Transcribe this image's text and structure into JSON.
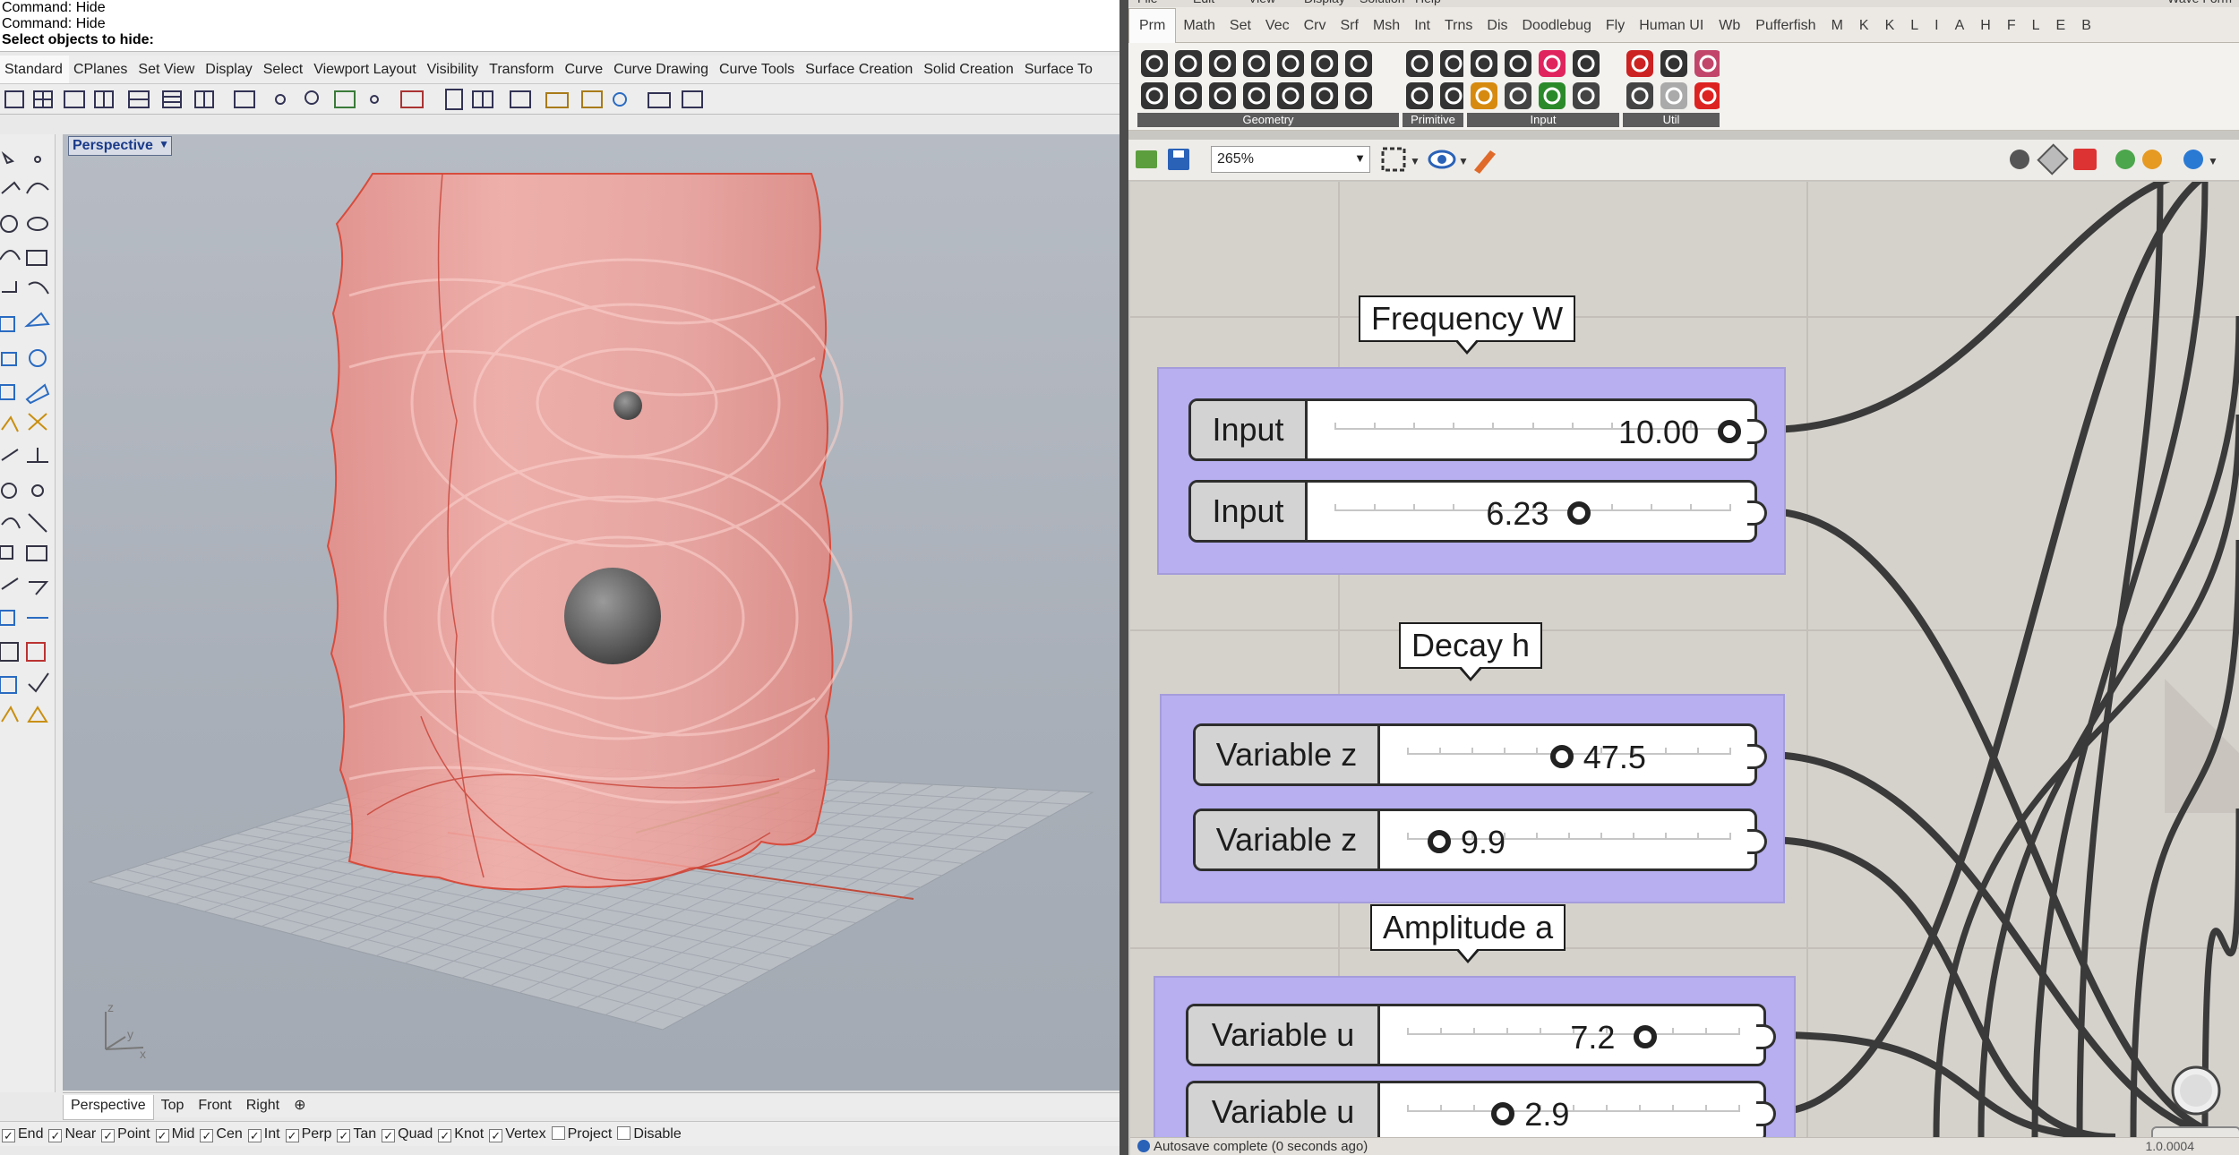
{
  "rhino": {
    "command_lines": [
      "Command: Hide",
      "Command: Hide"
    ],
    "prompt": "Select objects to hide:",
    "toolbar_tabs": [
      "Standard",
      "CPlanes",
      "Set View",
      "Display",
      "Select",
      "Viewport Layout",
      "Visibility",
      "Transform",
      "Curve",
      "Curve Drawing",
      "Curve Tools",
      "Surface Creation",
      "Solid Creation",
      "Surface To"
    ],
    "viewport_title": "Perspective",
    "axis_labels": {
      "z": "z",
      "y": "y",
      "x": "x"
    },
    "viewport_tabs": [
      "Perspective",
      "Top",
      "Front",
      "Right"
    ],
    "add_viewport_tab": "⊕",
    "osnaps": [
      {
        "label": "End",
        "checked": true
      },
      {
        "label": "Near",
        "checked": true
      },
      {
        "label": "Point",
        "checked": true
      },
      {
        "label": "Mid",
        "checked": true
      },
      {
        "label": "Cen",
        "checked": true
      },
      {
        "label": "Int",
        "checked": true
      },
      {
        "label": "Perp",
        "checked": true
      },
      {
        "label": "Tan",
        "checked": true
      },
      {
        "label": "Quad",
        "checked": true
      },
      {
        "label": "Knot",
        "checked": true
      },
      {
        "label": "Vertex",
        "checked": true
      },
      {
        "label": "Project",
        "checked": false
      },
      {
        "label": "Disable",
        "checked": false
      }
    ],
    "colors": {
      "surface": "#f0a49e",
      "edge": "#d94a3a",
      "viewport_bg": "#aeb3bb"
    }
  },
  "grasshopper": {
    "menu_partial": [
      "File",
      "Edit",
      "View",
      "Display",
      "Solution",
      "Help"
    ],
    "window_title_partial": "Wave Form",
    "tabs": [
      "Prm",
      "Math",
      "Set",
      "Vec",
      "Crv",
      "Srf",
      "Msh",
      "Int",
      "Trns",
      "Dis",
      "Doodlebug",
      "Fly",
      "Human UI",
      "Wb",
      "Pufferfish",
      "M",
      "K",
      "K",
      "L",
      "I",
      "A",
      "H",
      "F",
      "L",
      "E",
      "B"
    ],
    "ribbon_groups": [
      "Geometry",
      "Primitive",
      "Input",
      "Util"
    ],
    "zoom": "265%",
    "groups": [
      {
        "title": "Frequency W",
        "sliders": [
          {
            "label": "Input",
            "value": "10.00",
            "fraction": 1.0
          },
          {
            "label": "Input",
            "value": "6.23",
            "fraction": 0.62
          }
        ]
      },
      {
        "title": "Decay h",
        "sliders": [
          {
            "label": "Variable z",
            "value": "47.5",
            "fraction": 0.48
          },
          {
            "label": "Variable z",
            "value": "9.9",
            "fraction": 0.1
          }
        ]
      },
      {
        "title": "Amplitude a",
        "sliders": [
          {
            "label": "Variable u",
            "value": "7.2",
            "fraction": 0.72
          },
          {
            "label": "Variable u",
            "value": "2.9",
            "fraction": 0.29
          }
        ]
      }
    ],
    "status": "Autosave complete (0 seconds ago)",
    "version": "1.0.0004",
    "colors": {
      "group": "#b7aff0",
      "canvas": "#d5d2cc",
      "wire": "#3a3a3a"
    }
  }
}
